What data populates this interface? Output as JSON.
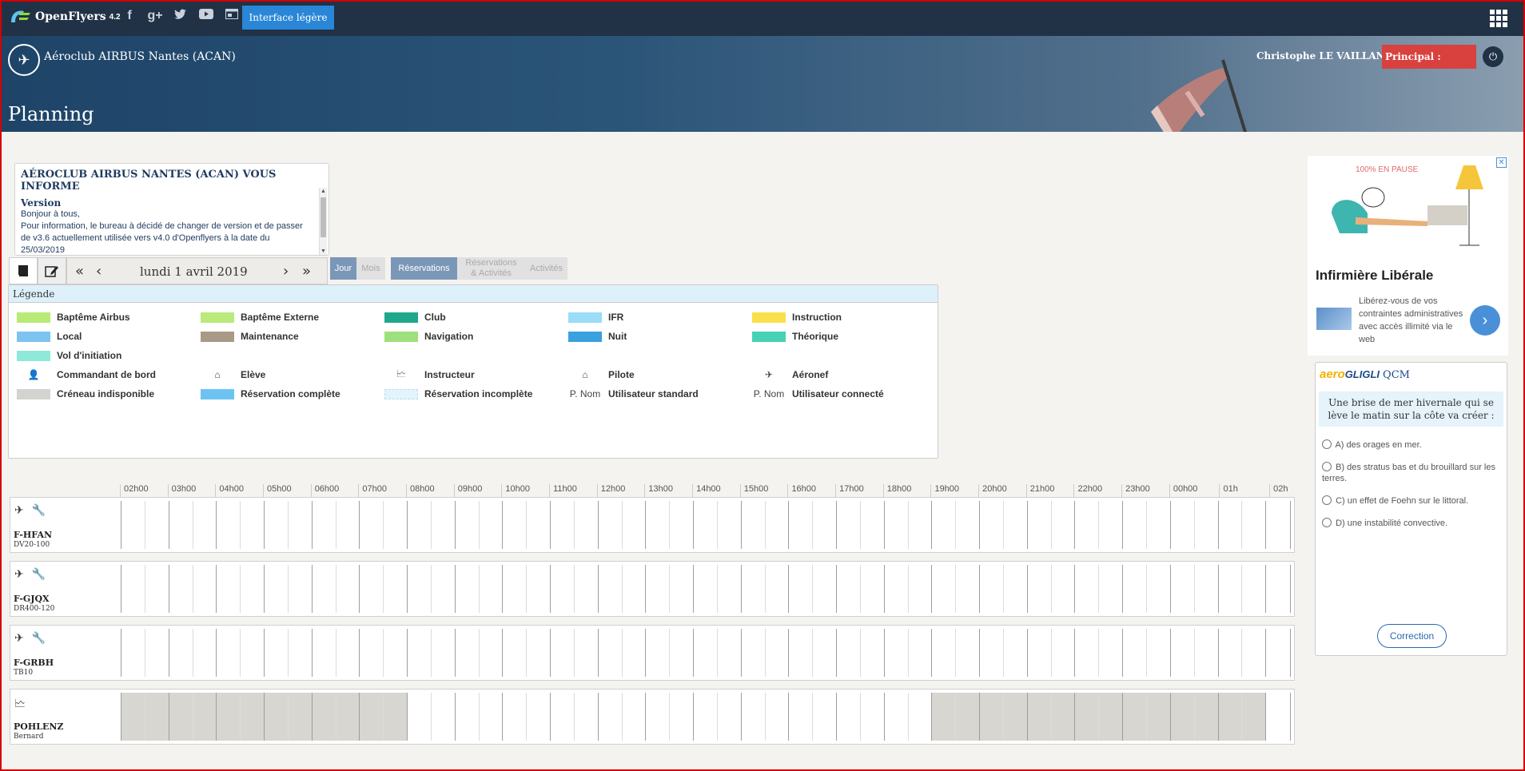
{
  "app": {
    "name": "OpenFlyers",
    "version": "4.2",
    "light_button": "Interface légère"
  },
  "social": [
    "f",
    "g+",
    "twitter",
    "youtube",
    "window"
  ],
  "header": {
    "club": "Aéroclub AIRBUS Nantes (ACAN)",
    "title": "Planning",
    "user": "Christophe LE VAILLANT",
    "principal": "Principal :"
  },
  "info": {
    "title": "AÉROCLUB AIRBUS NANTES (ACAN) VOUS INFORME",
    "subtitle": "Version",
    "line1": " Bonjour à tous,",
    "line2": "Pour information, le bureau à décidé de changer de version et de passer de v3.6 actuellement utilisée vers v4.0 d'Openflyers à la date du 25/03/2019"
  },
  "toolbar": {
    "date": "lundi 1 avril 2019",
    "jour": "Jour",
    "mois": "Mois",
    "reservations": "Réservations",
    "res_activites_1": "Réservations",
    "res_activites_2": "& Activités",
    "activites": "Activités"
  },
  "legend": {
    "title": "Légende",
    "items": [
      {
        "label": "Baptême Airbus",
        "color": "#b7eb76"
      },
      {
        "label": "Baptême Externe",
        "color": "#b9ea7b"
      },
      {
        "label": "Club",
        "color": "#1fa78c"
      },
      {
        "label": "IFR",
        "color": "#9bdcf7"
      },
      {
        "label": "Instruction",
        "color": "#f9e04b"
      },
      {
        "label": "Local",
        "color": "#7cc4ef"
      },
      {
        "label": "Maintenance",
        "color": "#a89a87"
      },
      {
        "label": "Navigation",
        "color": "#9ee07c"
      },
      {
        "label": "Nuit",
        "color": "#3aa0df"
      },
      {
        "label": "Théorique",
        "color": "#47d1b5"
      },
      {
        "label": "Vol d'initiation",
        "color": "#8ee9d9"
      }
    ],
    "symbols": [
      {
        "label": "Commandant de bord",
        "icon": "person-icon",
        "sym": "👤"
      },
      {
        "label": "Elève",
        "icon": "student-icon",
        "sym": "⌂"
      },
      {
        "label": "Instructeur",
        "icon": "instructor-icon",
        "sym": "🗠"
      },
      {
        "label": "Pilote",
        "icon": "pilot-icon",
        "sym": "⌂"
      },
      {
        "label": "Aéronef",
        "icon": "plane-icon",
        "sym": "✈"
      },
      {
        "label": "Créneau indisponible",
        "color": "#d3d3cf"
      },
      {
        "label": "Réservation complète",
        "color": "#6cc3f2"
      },
      {
        "label": "Réservation incomplète",
        "color": "#e3f4fc"
      },
      {
        "label": "Utilisateur standard",
        "prefix": "P. Nom"
      },
      {
        "label": "Utilisateur connecté",
        "prefix": "P. Nom"
      }
    ]
  },
  "planning": {
    "hours": [
      "02h00",
      "03h00",
      "04h00",
      "05h00",
      "06h00",
      "07h00",
      "08h00",
      "09h00",
      "10h00",
      "11h00",
      "12h00",
      "13h00",
      "14h00",
      "15h00",
      "16h00",
      "17h00",
      "18h00",
      "19h00",
      "20h00",
      "21h00",
      "22h00",
      "23h00",
      "00h00",
      "01h",
      "02h"
    ],
    "rows": [
      {
        "name": "F-HFAN",
        "sub": "DV20-100",
        "type": "aircraft"
      },
      {
        "name": "F-GJQX",
        "sub": "DR400-120",
        "type": "aircraft"
      },
      {
        "name": "F-GRBH",
        "sub": "TB10",
        "type": "aircraft"
      },
      {
        "name": "POHLENZ",
        "sub": "Bernard",
        "type": "instructor",
        "unavailable": [
          {
            "from": "02:00",
            "to": "08:00"
          },
          {
            "from": "19:00",
            "to": "02:00"
          }
        ]
      }
    ]
  },
  "ad": {
    "title": "Infirmière Libérale",
    "text": "Libérez-vous de vos contraintes administratives avec accès illimité via le web",
    "image_caption": "100% EN PAUSE"
  },
  "qcm": {
    "brand_a": "aero",
    "brand_b": "GLIGLI",
    "label": "QCM",
    "question": "Une brise de mer hivernale qui se lève le matin sur la côte va créer :",
    "options": [
      "A) des orages en mer.",
      "B) des stratus bas et du brouillard sur les terres.",
      "C) un effet de Foehn sur le littoral.",
      "D) une instabilité convective."
    ],
    "button": "Correction"
  }
}
